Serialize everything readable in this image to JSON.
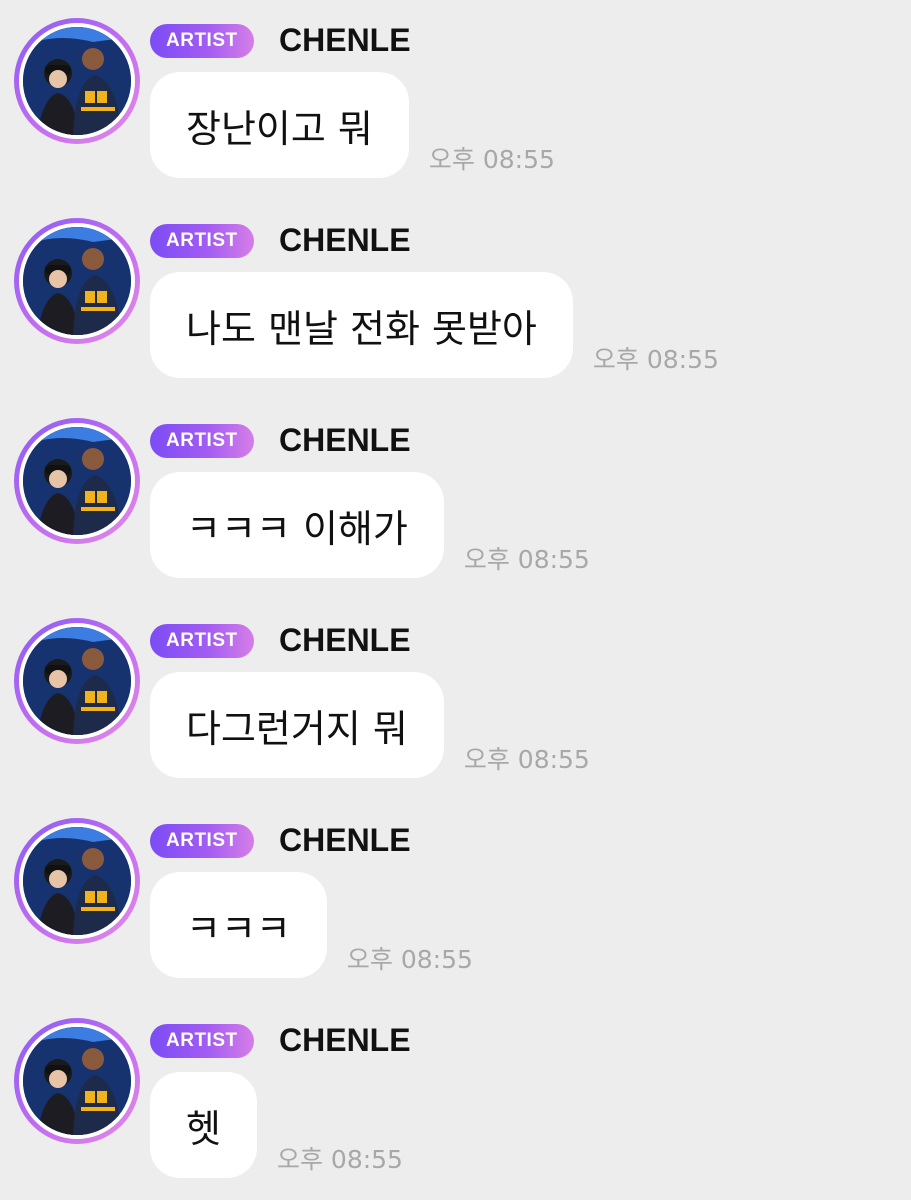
{
  "messages": [
    {
      "badge": "ARTIST",
      "sender": "CHENLE",
      "text": "장난이고 뭐",
      "time": "오후 08:55"
    },
    {
      "badge": "ARTIST",
      "sender": "CHENLE",
      "text": "나도 맨날 전화 못받아",
      "time": "오후 08:55"
    },
    {
      "badge": "ARTIST",
      "sender": "CHENLE",
      "text": "ㅋㅋㅋ 이해가",
      "time": "오후 08:55"
    },
    {
      "badge": "ARTIST",
      "sender": "CHENLE",
      "text": "다그런거지 뭐",
      "time": "오후 08:55"
    },
    {
      "badge": "ARTIST",
      "sender": "CHENLE",
      "text": "ㅋㅋㅋ",
      "time": "오후 08:55"
    },
    {
      "badge": "ARTIST",
      "sender": "CHENLE",
      "text": "헷",
      "time": "오후 08:55"
    }
  ],
  "colors": {
    "background": "#ededed",
    "bubble": "#ffffff",
    "badge_start": "#7b4cf5",
    "badge_end": "#d67ee8",
    "time_text": "#a8a8a8"
  },
  "icons": {
    "avatar": "profile-photo-avatar"
  }
}
